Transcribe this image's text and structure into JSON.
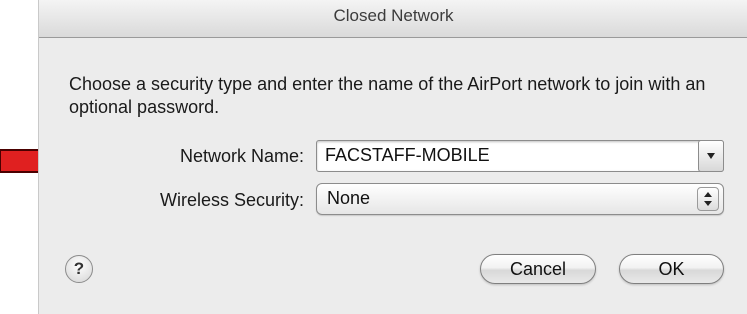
{
  "dialog": {
    "title": "Closed Network",
    "message": "Choose a security type and enter the name of the AirPort network to join with an optional password."
  },
  "form": {
    "network_name_label": "Network Name:",
    "network_name_value": "FACSTAFF-MOBILE",
    "security_label": "Wireless Security:",
    "security_value": "None"
  },
  "buttons": {
    "help": "?",
    "cancel": "Cancel",
    "ok": "OK"
  },
  "annotation": {
    "arrow_color": "#e02020",
    "arrow_icon": "red-arrow-icon"
  }
}
